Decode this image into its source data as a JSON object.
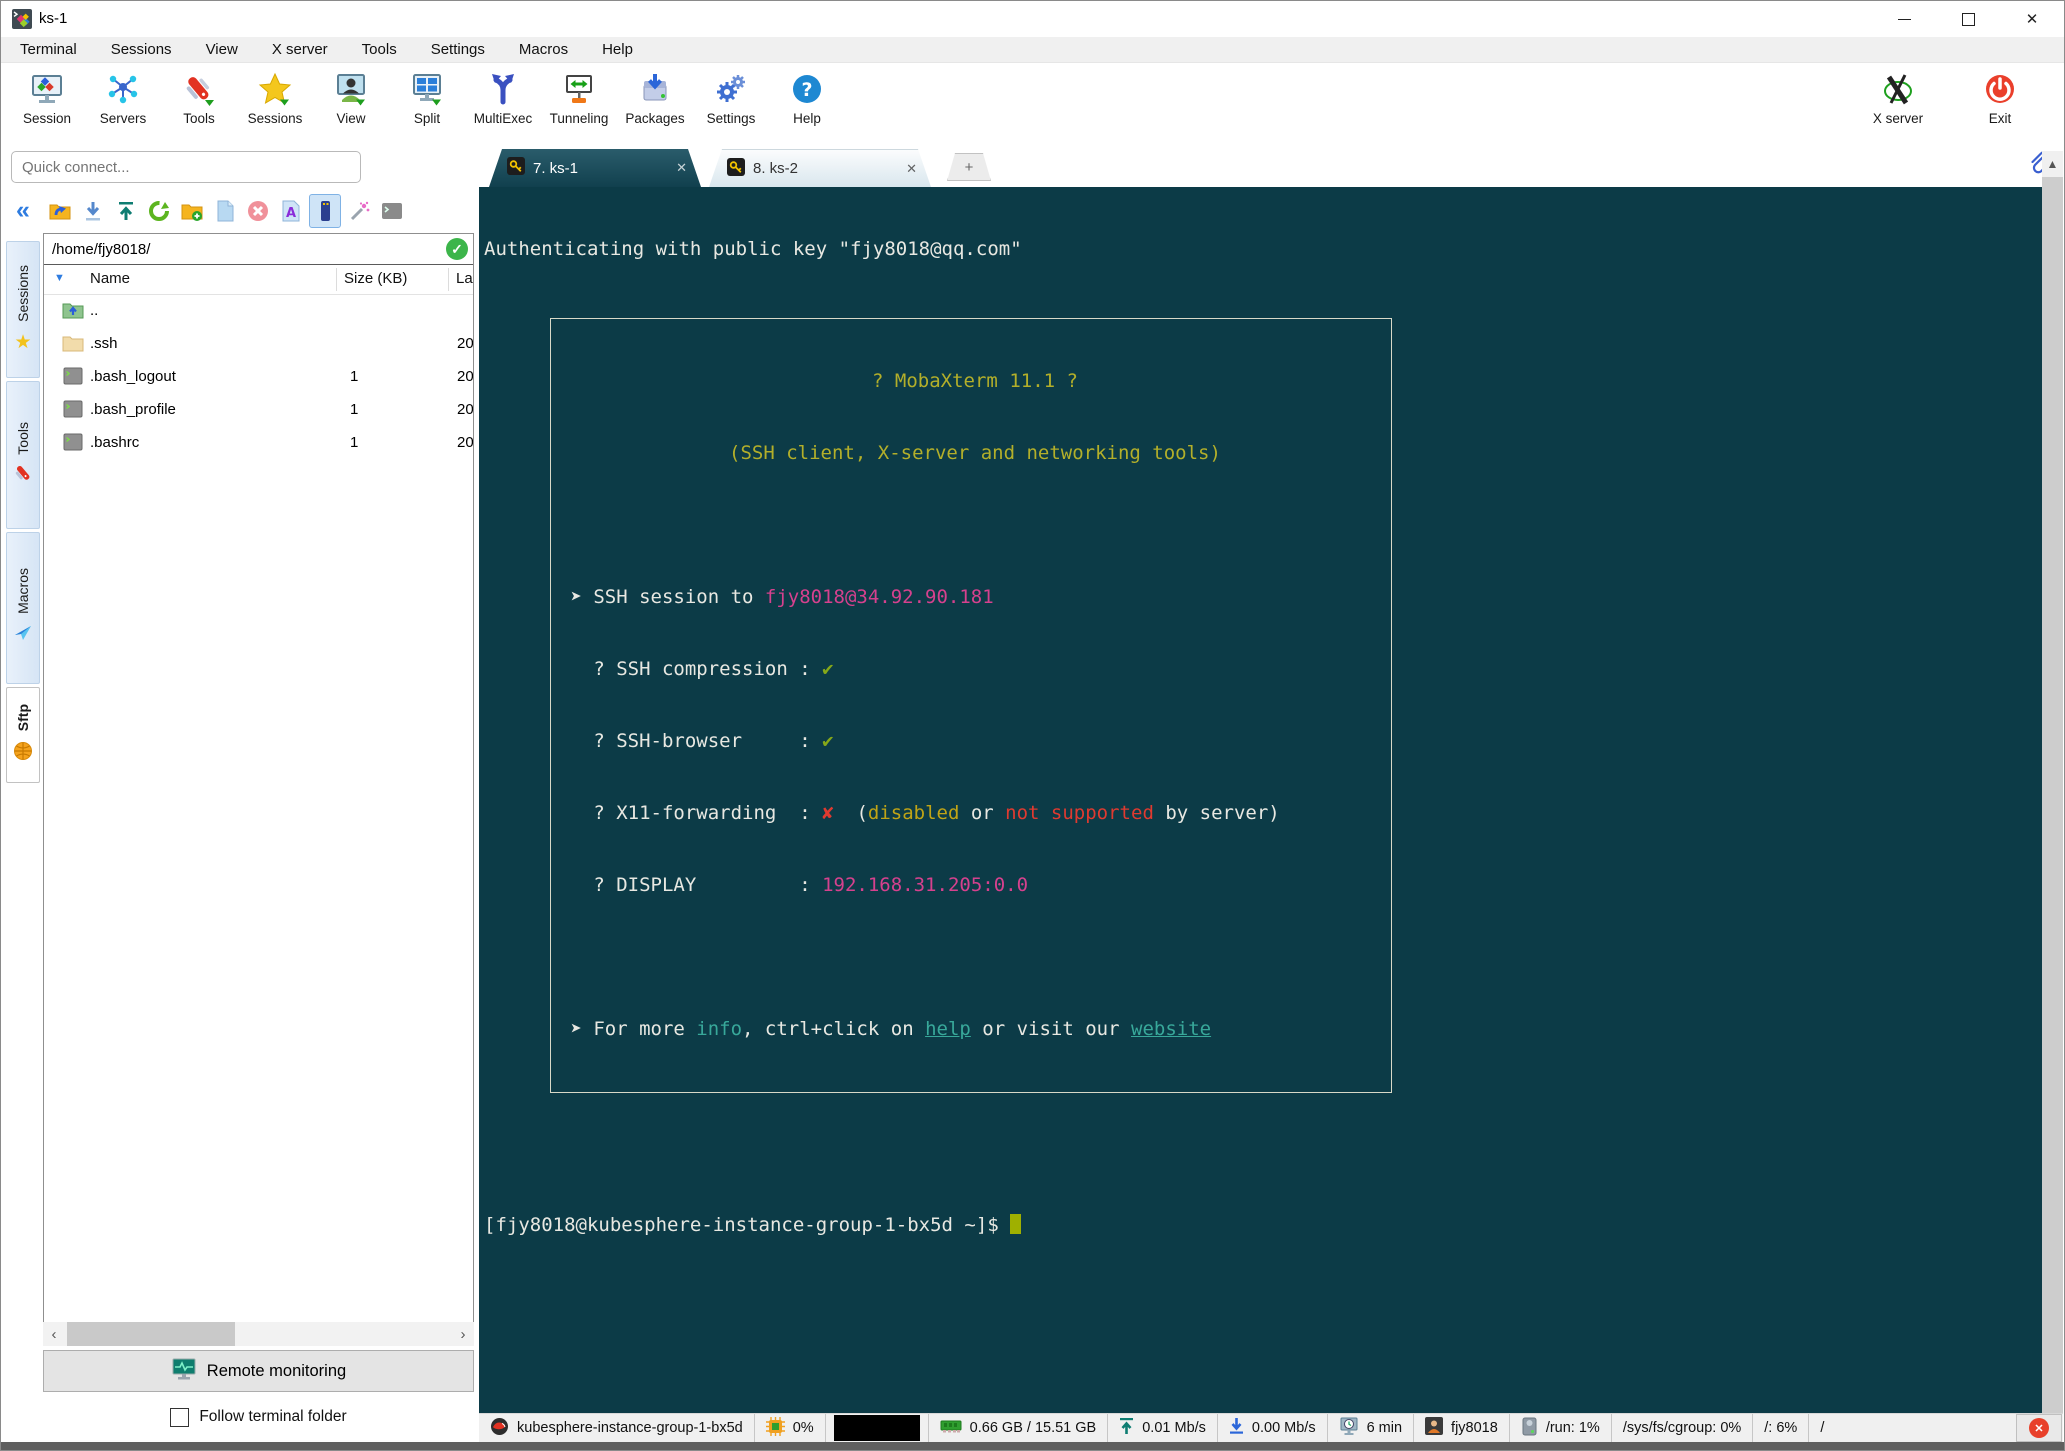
{
  "window": {
    "title": "ks-1"
  },
  "icons": {
    "collapse": "«",
    "scroll_left": "‹",
    "scroll_right": "›",
    "star": "★",
    "sort": "▼",
    "check": "✓",
    "new_tab": "+",
    "close_x": "✕"
  },
  "menu": {
    "items": [
      "Terminal",
      "Sessions",
      "View",
      "X server",
      "Tools",
      "Settings",
      "Macros",
      "Help"
    ]
  },
  "toolbar": {
    "items": [
      "Session",
      "Servers",
      "Tools",
      "Sessions",
      "View",
      "Split",
      "MultiExec",
      "Tunneling",
      "Packages",
      "Settings",
      "Help"
    ],
    "right_items": [
      "X server",
      "Exit"
    ]
  },
  "quick_connect": {
    "placeholder": "Quick connect..."
  },
  "sidebar": {
    "tabs": [
      "Sessions",
      "Tools",
      "Macros",
      "Sftp"
    ]
  },
  "sftp": {
    "path": "/home/fjy8018/",
    "columns": [
      "Name",
      "Size (KB)",
      "La"
    ],
    "files": [
      {
        "name": "..",
        "size": "",
        "modified": ""
      },
      {
        "name": ".ssh",
        "size": "",
        "modified": "20"
      },
      {
        "name": ".bash_logout",
        "size": "1",
        "modified": "20"
      },
      {
        "name": ".bash_profile",
        "size": "1",
        "modified": "20"
      },
      {
        "name": ".bashrc",
        "size": "1",
        "modified": "20"
      }
    ],
    "remote_monitoring": "Remote monitoring",
    "follow_terminal_folder": "Follow terminal folder"
  },
  "tabs": {
    "active": "7. ks-1",
    "inactive": "8. ks-2"
  },
  "terminal": {
    "auth_line": "Authenticating with public key \"fjy8018@qq.com\"",
    "banner_title": "? MobaXterm 11.1 ?",
    "banner_subtitle": "(SSH client, X-server and networking tools)",
    "ssh_prefix": " ➤ SSH session to ",
    "ssh_host": "fjy8018@34.92.90.181",
    "compression_label": "   ? SSH compression : ",
    "browser_label": "   ? SSH-browser     : ",
    "check_mark": "✔",
    "x11_label": "   ? X11-forwarding  : ",
    "cross_mark": "✘",
    "x11_open": "  (",
    "x11_disabled": "disabled",
    "x11_or": " or ",
    "x11_not_supported": "not supported",
    "x11_close": " by server)",
    "display_label": "   ? DISPLAY         : ",
    "display_value": "192.168.31.205:0.0",
    "more_prefix": " ➤ For more ",
    "more_info": "info",
    "more_mid1": ", ctrl+click on ",
    "more_help": "help",
    "more_mid2": " or visit our ",
    "more_website": "website",
    "prompt": "[fjy8018@kubesphere-instance-group-1-bx5d ~]$ "
  },
  "statusbar": {
    "host": "kubesphere-instance-group-1-bx5d",
    "cpu": "0%",
    "memory": "0.66 GB / 15.51 GB",
    "upload": "0.01 Mb/s",
    "download": "0.00 Mb/s",
    "uptime": "6 min",
    "user": "fjy8018",
    "mount_run": "/run: 1%",
    "mount_cgroup": "/sys/fs/cgroup: 0%",
    "mount_root": "/: 6%",
    "mount_truncated": "/"
  },
  "colors": {
    "terminal_bg": "#0c3b47",
    "banner_yellow": "#b3af2a",
    "magenta": "#d6418e",
    "green": "#86a819",
    "red": "#e03a30",
    "cyan": "#38a89a",
    "cursor": "#9fb000",
    "accent_blue": "#2e7ce0"
  }
}
